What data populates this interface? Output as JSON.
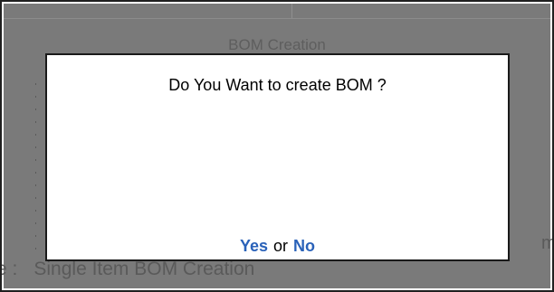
{
  "background": {
    "title": "BOM Creation",
    "right_fragment": "m",
    "bottom_row": {
      "label_fragment": "e",
      "separator": ":",
      "value": "Single Item BOM Creation"
    }
  },
  "dialog": {
    "message": "Do You Want to create BOM ?",
    "yes_label": "Yes",
    "or_text": "or",
    "no_label": "No"
  },
  "colors": {
    "overlay": "#7a7a7a",
    "action": "#2a62b9",
    "frame_border": "#202020"
  }
}
